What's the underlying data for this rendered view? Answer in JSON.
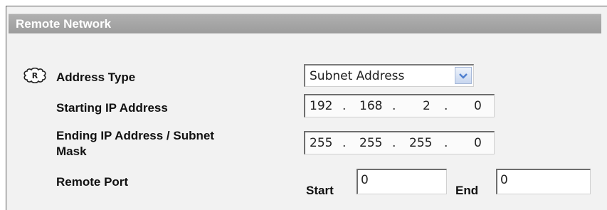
{
  "section": {
    "title": "Remote Network"
  },
  "address_type": {
    "label": "Address Type",
    "selected": "Subnet Address"
  },
  "starting_ip": {
    "label": "Starting IP Address",
    "octets": [
      "192",
      "168",
      "2",
      "0"
    ]
  },
  "ending_ip": {
    "label_line1": "Ending IP Address / Subnet",
    "label_line2": "Mask",
    "octets": [
      "255",
      "255",
      "255",
      "0"
    ]
  },
  "remote_port": {
    "label": "Remote Port",
    "start_label": "Start",
    "start_value": "0",
    "end_label": "End",
    "end_value": "0"
  },
  "icons": {
    "required": "required-marker-icon",
    "dropdown": "chevron-down-icon"
  },
  "colors": {
    "header_bg": "#a8a8a8",
    "panel_bg": "#f2f2f2",
    "dropdown_arrow": "#4f7fcf"
  }
}
